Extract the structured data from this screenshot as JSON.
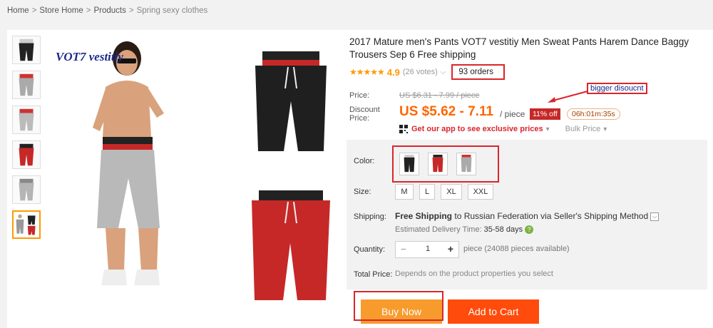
{
  "breadcrumb": {
    "items": [
      "Home",
      "Store Home",
      "Products"
    ],
    "current": "Spring sexy clothes",
    "separator": ">"
  },
  "gallery": {
    "brand_text": "VOT7 vestitiy",
    "thumbnail_count": 6,
    "active_thumbnail": 6
  },
  "product": {
    "title": "2017 Mature men's Pants VOT7 vestitiy Men Sweat Pants Harem Dance Baggy Trousers Sep 6 Free shipping",
    "stars": "★★★★★",
    "rating": "4.9",
    "votes": "(26 votes)",
    "orders": "93 orders"
  },
  "price": {
    "label": "Price:",
    "original": "US $6.31 - 7.99 / piece",
    "discount_label": "Discount Price:",
    "discount": "US $5.62 - 7.11",
    "per_piece": "/ piece",
    "off_badge": "11% off",
    "timer": "06h:01m:35s",
    "app_link": "Get our app to see exclusive prices",
    "bulk": "Bulk Price",
    "callout": "bigger disoucnt"
  },
  "options": {
    "color_label": "Color:",
    "size_label": "Size:",
    "sizes": [
      "M",
      "L",
      "XL",
      "XXL"
    ],
    "shipping_label": "Shipping:",
    "shipping_free": "Free Shipping",
    "shipping_rest": "to Russian Federation via Seller's Shipping Method",
    "eta_label": "Estimated Delivery Time:",
    "eta_value": "35-58 days",
    "quantity_label": "Quantity:",
    "quantity_value": "1",
    "minus": "−",
    "plus": "+",
    "pieces_available": "piece (24088 pieces available)",
    "total_label": "Total Price:",
    "total_value": "Depends on the product properties you select"
  },
  "actions": {
    "buy_now": "Buy Now",
    "add_to_cart": "Add to Cart"
  },
  "colors": {
    "accent_orange": "#f60",
    "buy_now_bg": "#f79b2c",
    "add_cart_bg": "#ff4b0b",
    "annotation_red": "#d9262c"
  }
}
